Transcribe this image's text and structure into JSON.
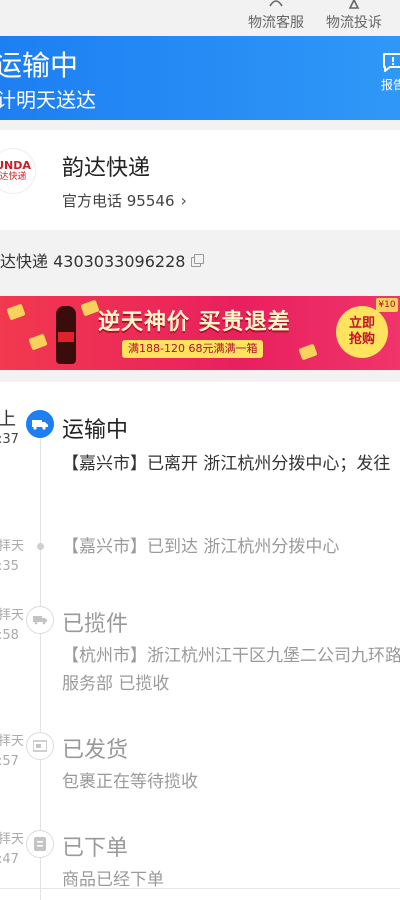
{
  "top_links": [
    {
      "label": "物流客服",
      "icon": "headset-icon"
    },
    {
      "label": "物流投诉",
      "icon": "complaint-icon"
    }
  ],
  "status": {
    "title": "运输中",
    "subtitle": "计明天送达",
    "report_label": "报告",
    "background": "#1d7ff2"
  },
  "courier": {
    "logo_line1": "UNDA",
    "logo_line2": "达快递",
    "name": "韵达快递",
    "phone": "官方电话 95546",
    "chevron": "›"
  },
  "tracking": {
    "text": "达快递 4303033096228"
  },
  "banner": {
    "title": "逆天神价 买贵退差",
    "subtitle": "满188-120 68元满满一箱",
    "button_line1": "立即",
    "button_line2": "抢购",
    "tag": "¥10"
  },
  "timeline": [
    {
      "time_top": "上",
      "time_bottom": ":37",
      "status": "运输中",
      "desc": "【嘉兴市】已离开 浙江杭州分拨中心；发往",
      "icon": "truck-icon",
      "active": true
    },
    {
      "time_top": "拝天",
      "time_bottom": ":35",
      "status": "",
      "desc": "【嘉兴市】已到达 浙江杭州分拨中心",
      "icon": "dot",
      "active": false
    },
    {
      "time_top": "拝天",
      "time_bottom": ":58",
      "status": "已揽件",
      "desc": "【杭州市】浙江杭州江干区九堡二公司九环路服务部 已揽收",
      "icon": "pickup-icon",
      "active": false
    },
    {
      "time_top": "拝天",
      "time_bottom": ":57",
      "status": "已发货",
      "desc": "包裹正在等待揽收",
      "icon": "package-icon",
      "active": false
    },
    {
      "time_top": "拝天",
      "time_bottom": ":47",
      "status": "已下单",
      "desc": "商品已经下单",
      "icon": "order-icon",
      "active": false
    }
  ]
}
